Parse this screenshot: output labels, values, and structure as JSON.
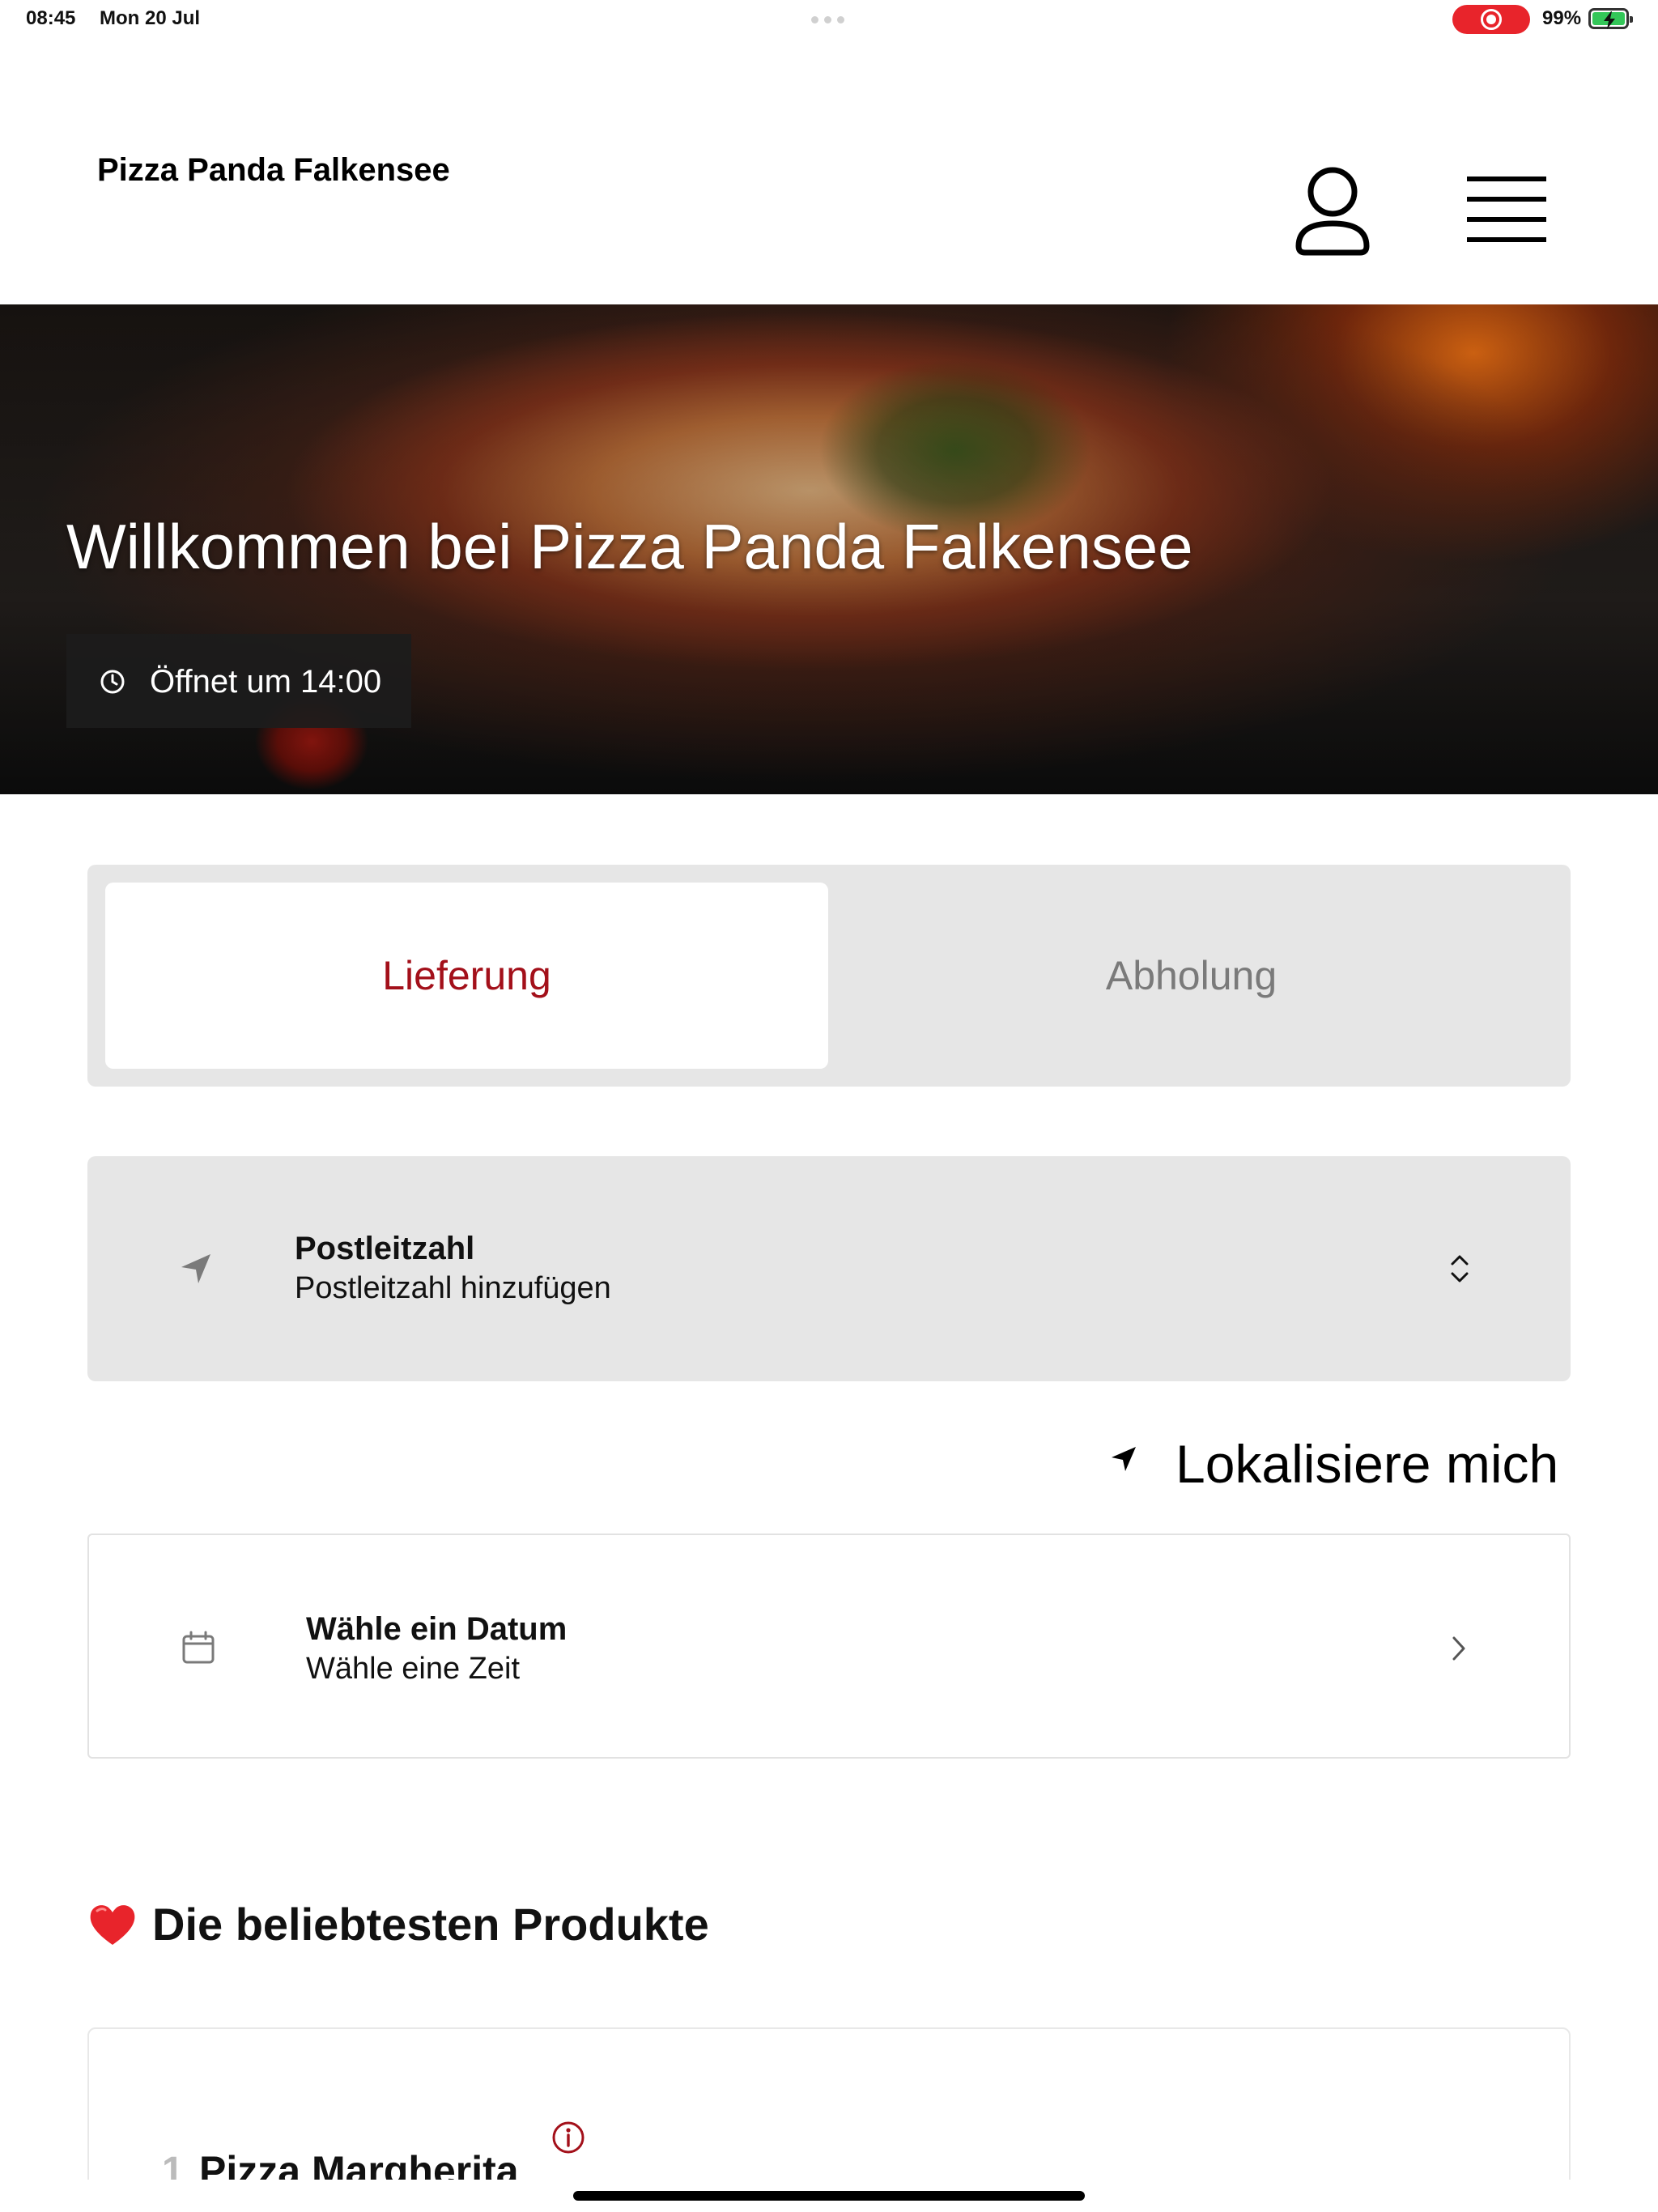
{
  "status_bar": {
    "time": "08:45",
    "date": "Mon 20 Jul",
    "battery_percent": "99%",
    "recording_color": "#e8242b",
    "battery_color": "#34c759"
  },
  "header": {
    "brand": "Pizza Panda Falkensee",
    "user_icon": "person-icon",
    "menu_icon": "hamburger-menu-icon"
  },
  "hero": {
    "title": "Willkommen bei Pizza Panda Falkensee",
    "opening_label": "Öffnet um 14:00",
    "opening_icon": "clock-icon"
  },
  "mode_toggle": {
    "active_color": "#a3101a",
    "tabs": [
      {
        "label": "Lieferung",
        "active": true
      },
      {
        "label": "Abholung",
        "active": false
      }
    ]
  },
  "postcode": {
    "title": "Postleitzahl",
    "placeholder": "Postleitzahl hinzufügen",
    "icon": "location-arrow-icon",
    "trailing_icon": "chevron-up-down-icon"
  },
  "locate": {
    "label": "Lokalisiere mich",
    "icon": "location-arrow-icon"
  },
  "date_picker": {
    "title": "Wähle ein Datum",
    "subtitle": "Wähle eine Zeit",
    "icon": "calendar-icon",
    "trailing_icon": "chevron-right-icon"
  },
  "popular": {
    "title": "Die beliebtesten Produkte",
    "icon": "heart-icon",
    "products": [
      {
        "rank": "1",
        "name": "Pizza Margherita",
        "info_icon": "info-icon"
      }
    ]
  }
}
